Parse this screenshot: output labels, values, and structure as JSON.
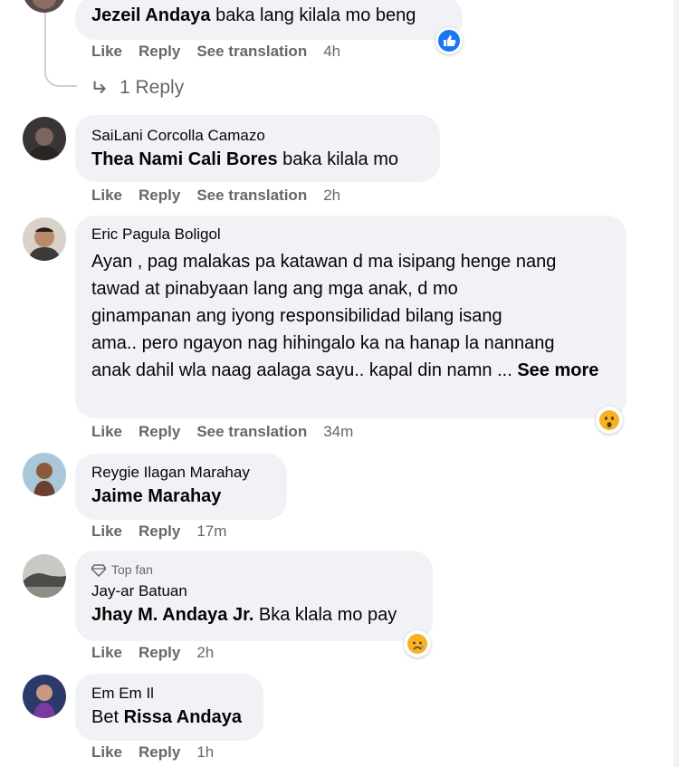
{
  "comments": [
    {
      "tagged": "Jezeil Andaya",
      "text": " baka lang kilala mo beng",
      "actions": {
        "like": "Like",
        "reply": "Reply",
        "translate": "See translation",
        "time": "4h"
      },
      "reaction": "like-icon"
    },
    {
      "author": "SaiLani Corcolla Camazo",
      "tagged": "Thea Nami Cali Bores",
      "text": " baka kilala mo",
      "actions": {
        "like": "Like",
        "reply": "Reply",
        "translate": "See translation",
        "time": "2h"
      }
    },
    {
      "author": "Eric Pagula Boligol",
      "text_lines": [
        "Ayan , pag malakas pa katawan d ma isipang henge nang",
        "tawad at pinabyaan lang ang mga anak, d mo",
        "ginampanan ang iyong responsibilidad bilang isang",
        "ama.. pero ngayon nag hihingalo ka na hanap la nannang",
        "anak dahil wla naag aalaga sayu.. kapal din namn ... "
      ],
      "see_more": "See more",
      "actions": {
        "like": "Like",
        "reply": "Reply",
        "translate": "See translation",
        "time": "34m"
      },
      "reaction": "wow-icon"
    },
    {
      "author": "Reygie Ilagan Marahay",
      "tagged": "Jaime Marahay",
      "actions": {
        "like": "Like",
        "reply": "Reply",
        "time": "17m"
      }
    },
    {
      "badge": "Top fan",
      "author": "Jay-ar Batuan",
      "tagged": "Jhay M. Andaya Jr.",
      "text": " Bka klala mo pay",
      "actions": {
        "like": "Like",
        "reply": "Reply",
        "time": "2h"
      },
      "reaction": "sad-icon"
    },
    {
      "author": "Em Em Il",
      "text": "Bet ",
      "tagged": "Rissa Andaya",
      "actions": {
        "like": "Like",
        "reply": "Reply",
        "time": "1h"
      }
    }
  ],
  "replies_link": "1 Reply",
  "colors": {
    "bubble": "#f0f2f5",
    "meta": "#65676b",
    "like_blue": "#1877f2",
    "emoji": "#f7b125"
  }
}
